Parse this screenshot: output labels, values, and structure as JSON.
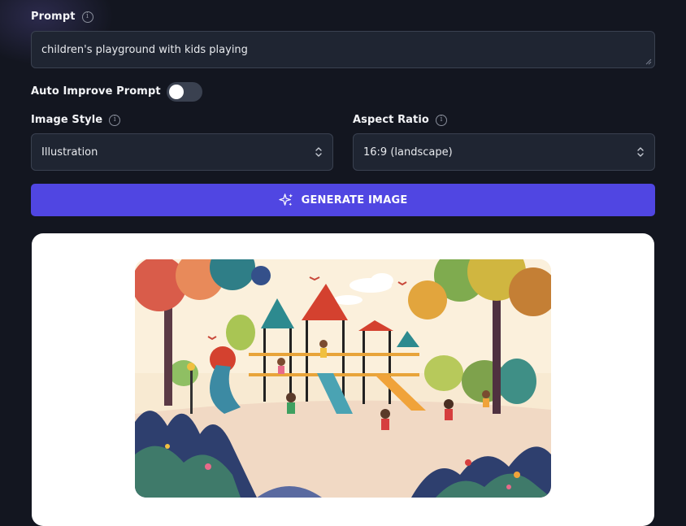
{
  "prompt": {
    "label": "Prompt",
    "value": "children's playground with kids playing"
  },
  "auto_improve": {
    "label": "Auto Improve Prompt",
    "enabled": false
  },
  "image_style": {
    "label": "Image Style",
    "selected": "Illustration"
  },
  "aspect_ratio": {
    "label": "Aspect Ratio",
    "selected": "16:9 (landscape)"
  },
  "generate_button": {
    "label": "GENERATE IMAGE",
    "icon": "sparkles-icon"
  },
  "result": {
    "image_icon": "playground-illustration"
  },
  "colors": {
    "background": "#131620",
    "field_background": "#1f2532",
    "accent": "#5046e2",
    "card": "#ffffff"
  }
}
